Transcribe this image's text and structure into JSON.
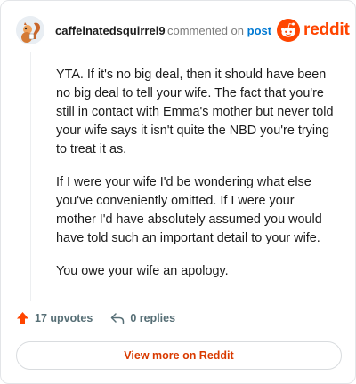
{
  "header": {
    "username": "caffeinatedsquirrel9",
    "commented_on": "commented on",
    "post_link": "post",
    "logo_text": "reddit"
  },
  "comment": {
    "paragraphs": [
      "YTA. If it's no big deal, then it should have been no big deal to tell your wife. The fact that you're still in contact with Emma's mother but never told your wife says it isn't quite the NBD you're trying to treat it as.",
      "If I were your wife I'd be wondering what else you've conveniently omitted. If I were your mother I'd have absolutely assumed you would have told such an important detail to your wife.",
      "You owe your wife an apology."
    ]
  },
  "actions": {
    "upvotes": "17 upvotes",
    "replies": "0 replies"
  },
  "footer": {
    "view_more": "View more on Reddit"
  },
  "colors": {
    "accent": "#ff4500",
    "link": "#0079d3",
    "muted": "#7c7c7c",
    "button_text": "#d93a00"
  },
  "icons": [
    "avatar-squirrel",
    "reddit-alien-icon",
    "upvote-arrow-icon",
    "reply-icon"
  ]
}
